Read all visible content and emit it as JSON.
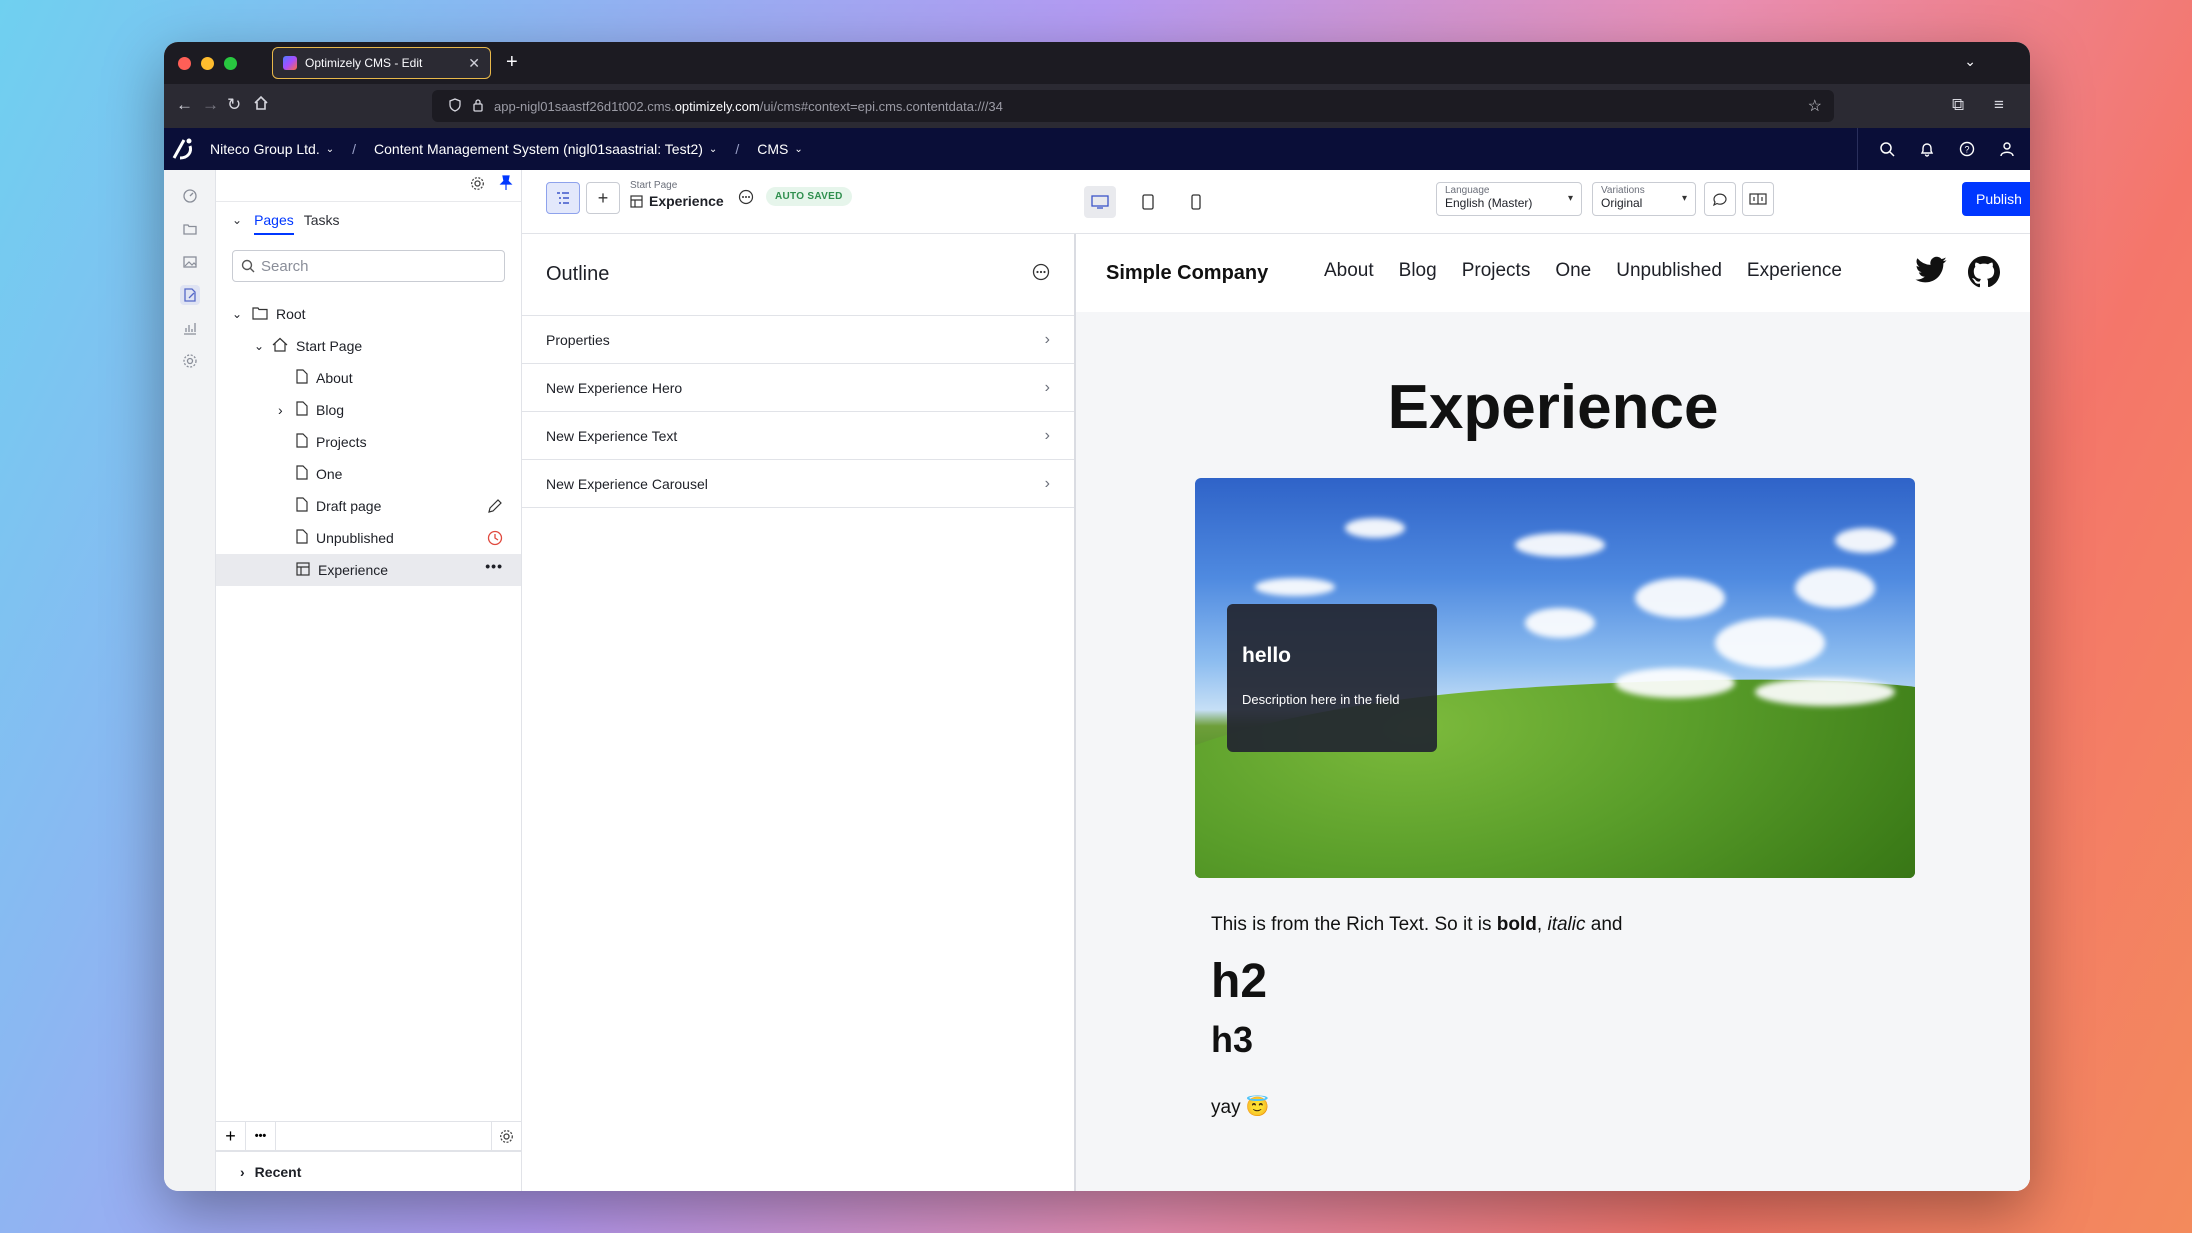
{
  "browser": {
    "tab_title": "Optimizely CMS - Edit",
    "url_prefix": "app-nigl01saastf26d1t002.cms.",
    "url_host": "optimizely.com",
    "url_path": "/ui/cms#context=epi.cms.contentdata:///34"
  },
  "cms_bar": {
    "org": "Niteco Group Ltd.",
    "app": "Content Management System (nigl01saastrial: Test2)",
    "section": "CMS"
  },
  "tree": {
    "tabs": {
      "pages": "Pages",
      "tasks": "Tasks"
    },
    "search_placeholder": "Search",
    "nodes": {
      "root": "Root",
      "start": "Start Page",
      "about": "About",
      "blog": "Blog",
      "projects": "Projects",
      "one": "One",
      "draft": "Draft page",
      "unpublished": "Unpublished",
      "experience": "Experience"
    },
    "recent": "Recent"
  },
  "toolbar": {
    "parent": "Start Page",
    "title": "Experience",
    "status": "AUTO SAVED",
    "language_label": "Language",
    "language_value": "English (Master)",
    "variations_label": "Variations",
    "variations_value": "Original",
    "publish": "Publish"
  },
  "outline": {
    "title": "Outline",
    "rows": [
      "Properties",
      "New Experience Hero",
      "New Experience Text",
      "New Experience Carousel"
    ]
  },
  "site": {
    "brand": "Simple Company",
    "nav": [
      "About",
      "Blog",
      "Projects",
      "One",
      "Unpublished",
      "Experience"
    ],
    "heading": "Experience",
    "hero_title": "hello",
    "hero_desc": "Description here in the field",
    "rich_start": "This is from the Rich Text. So it is ",
    "rich_bold": "bold",
    "rich_comma": ", ",
    "rich_italic": "italic",
    "rich_end": " and",
    "h2": "h2",
    "h3": "h3",
    "yay": "yay 😇"
  },
  "colors": {
    "cms_navy": "#0a0e38",
    "publish_blue": "#0037ff",
    "autosaved_green": "#2f8f4e"
  },
  "icons": [
    "search-icon",
    "bell-icon",
    "help-icon",
    "user-icon",
    "gear-icon",
    "pin-icon",
    "folder-icon",
    "home-icon",
    "page-icon",
    "pencil-icon",
    "clock-icon",
    "more-icon",
    "desktop-icon",
    "tablet-icon",
    "phone-icon",
    "comment-icon",
    "compare-icon",
    "view-icon",
    "twitter-icon",
    "github-icon"
  ]
}
